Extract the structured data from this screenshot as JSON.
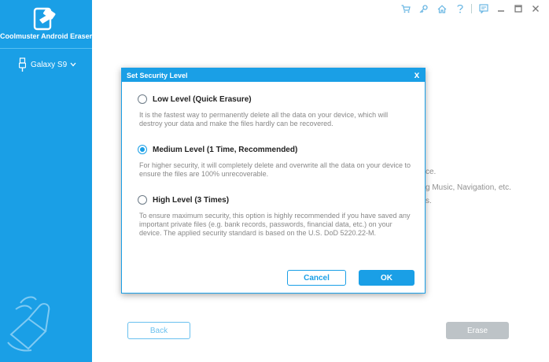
{
  "app": {
    "title": "Coolmuster Android Eraser",
    "device_label": "Galaxy S9"
  },
  "topbar": {
    "icons": [
      "cart-icon",
      "key-icon",
      "home-icon",
      "help-icon",
      "feedback-icon"
    ],
    "window_controls": [
      "minimize-icon",
      "maximize-icon",
      "close-icon"
    ]
  },
  "background": {
    "line1": "ce.",
    "line2": "g Music, Navigation, etc.",
    "line3": "s.",
    "back_label": "Back",
    "erase_label": "Erase"
  },
  "dialog": {
    "title": "Set Security Level",
    "close_glyph": "x",
    "options": [
      {
        "label": "Low Level (Quick Erasure)",
        "description": "It is the fastest way to permanently delete all the data on your device, which will destroy your data and make the files hardly can be recovered.",
        "selected": false
      },
      {
        "label": "Medium Level (1 Time, Recommended)",
        "description": "For higher security, it will completely delete and overwrite all the data on your device to ensure the files are 100% unrecoverable.",
        "selected": true
      },
      {
        "label": "High Level (3 Times)",
        "description": "To ensure maximum security, this option is highly recommended if you have saved any important private files (e.g. bank records, passwords, financial data, etc.) on your device. The applied security standard is based on the U.S. DoD 5220.22-M.",
        "selected": false
      }
    ],
    "cancel_label": "Cancel",
    "ok_label": "OK"
  },
  "colors": {
    "accent": "#1a9fe6",
    "sidebar": "#1a9fe6",
    "erase_disabled": "#9aa3aa"
  }
}
